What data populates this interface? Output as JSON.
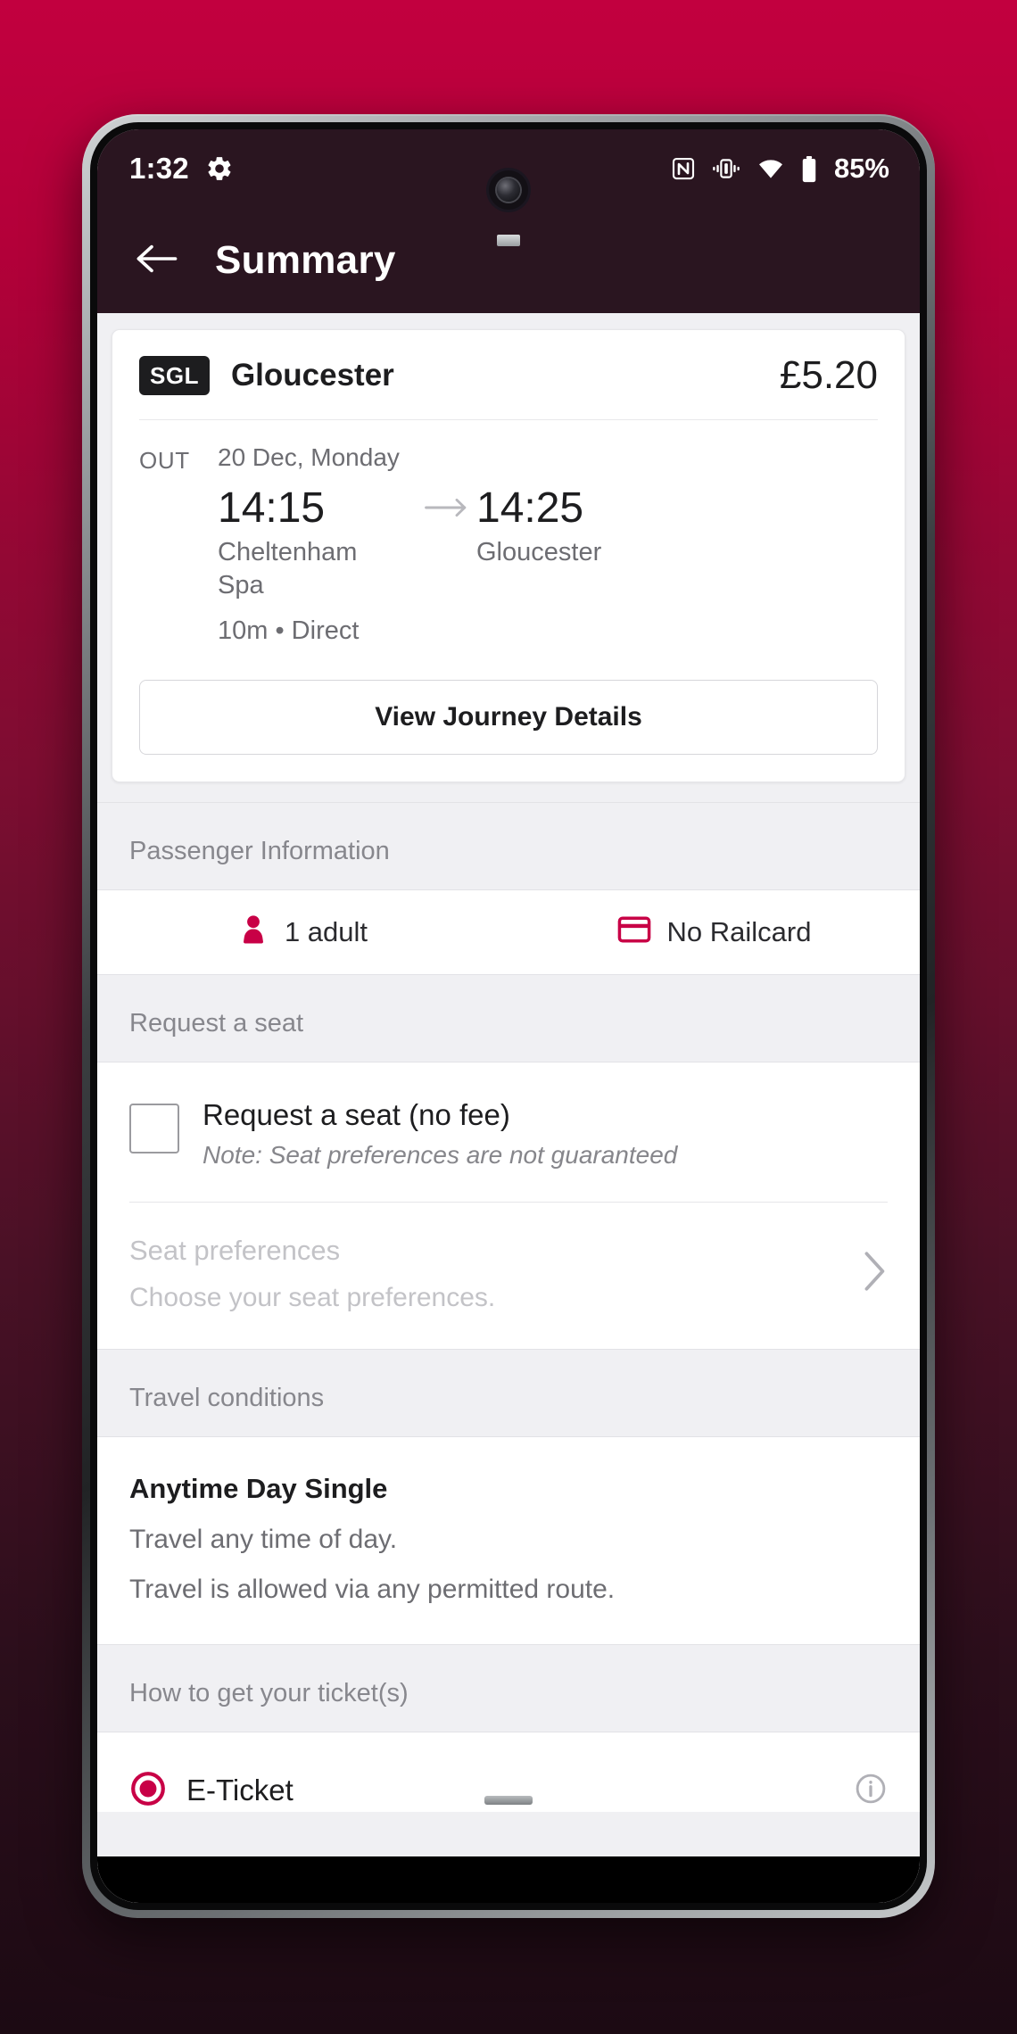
{
  "statusbar": {
    "time": "1:32",
    "gear_icon": "gear-icon",
    "nfc_icon": "nfc-icon",
    "vibrate_icon": "vibrate-icon",
    "wifi_icon": "wifi-icon",
    "battery_icon": "battery-icon",
    "battery_percent": "85%"
  },
  "appbar": {
    "back_icon": "back-arrow-icon",
    "title": "Summary"
  },
  "ticket": {
    "badge": "SGL",
    "destination": "Gloucester",
    "price": "£5.20",
    "direction": "OUT",
    "date": "20 Dec, Monday",
    "depart_time": "14:15",
    "depart_station": "Cheltenham Spa",
    "arrive_time": "14:25",
    "arrive_station": "Gloucester",
    "arrow_icon": "arrow-right-icon",
    "duration_changes": "10m • Direct",
    "details_button": "View Journey Details"
  },
  "passenger": {
    "section_title": "Passenger Information",
    "adult_icon": "passenger-icon",
    "adults": "1 adult",
    "railcard_icon": "railcard-icon",
    "railcard": "No Railcard"
  },
  "seat": {
    "section_title": "Request a seat",
    "checkbox_label": "Request a seat (no fee)",
    "checkbox_note": "Note: Seat preferences are not guaranteed",
    "checkbox_checked": false,
    "preferences_title": "Seat preferences",
    "preferences_subtitle": "Choose your seat preferences.",
    "chevron_icon": "chevron-right-icon"
  },
  "conditions": {
    "section_title": "Travel conditions",
    "fare_name": "Anytime Day Single",
    "lines": [
      "Travel any time of day.",
      "Travel is allowed via any permitted route."
    ]
  },
  "delivery": {
    "section_title": "How to get your ticket(s)",
    "option_label": "E-Ticket",
    "radio_selected": true,
    "info_icon": "info-icon"
  },
  "colors": {
    "brand_crimson": "#c80046",
    "appbar_dark": "#2a1520",
    "page_background": "#f0f0f3"
  }
}
